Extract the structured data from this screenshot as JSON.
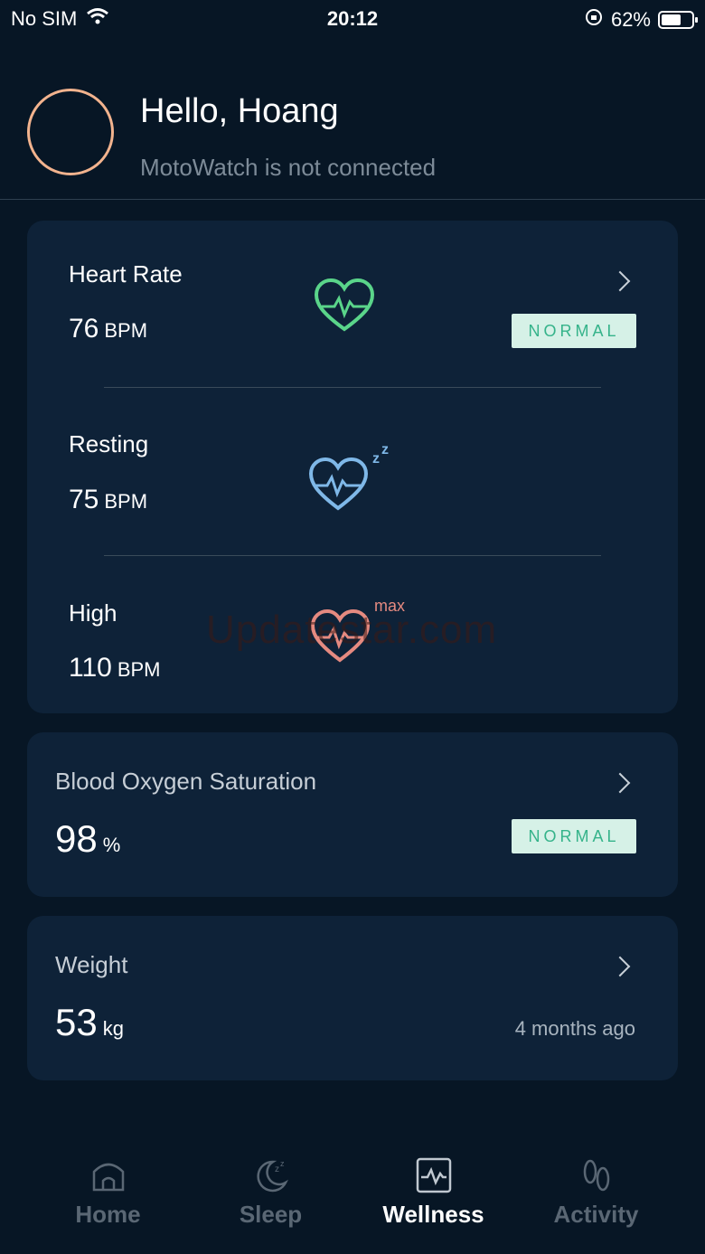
{
  "status_bar": {
    "carrier": "No SIM",
    "time": "20:12",
    "battery": "62%"
  },
  "header": {
    "greeting": "Hello, Hoang",
    "connection_status": "MotoWatch is not connected"
  },
  "heart_rate": {
    "title": "Heart Rate",
    "value": "76",
    "unit": "BPM",
    "status": "NORMAL",
    "resting": {
      "title": "Resting",
      "value": "75",
      "unit": "BPM"
    },
    "high": {
      "title": "High",
      "value": "110",
      "unit": "BPM",
      "icon_tag": "max"
    }
  },
  "blood_oxygen": {
    "title": "Blood Oxygen Saturation",
    "value": "98",
    "unit": "%",
    "status": "NORMAL"
  },
  "weight": {
    "title": "Weight",
    "value": "53",
    "unit": "kg",
    "updated": "4 months ago"
  },
  "watermark": "Updatestar.com",
  "tabs": [
    {
      "label": "Home",
      "icon": "home-icon"
    },
    {
      "label": "Sleep",
      "icon": "sleep-icon"
    },
    {
      "label": "Wellness",
      "icon": "wellness-icon",
      "active": true
    },
    {
      "label": "Activity",
      "icon": "footprints-icon"
    }
  ],
  "colors": {
    "accent_green": "#35b38a",
    "heart_green": "#5ad58a",
    "heart_blue": "#7fb8e8",
    "heart_red": "#e58a80",
    "avatar_ring": "#f2b38e"
  }
}
